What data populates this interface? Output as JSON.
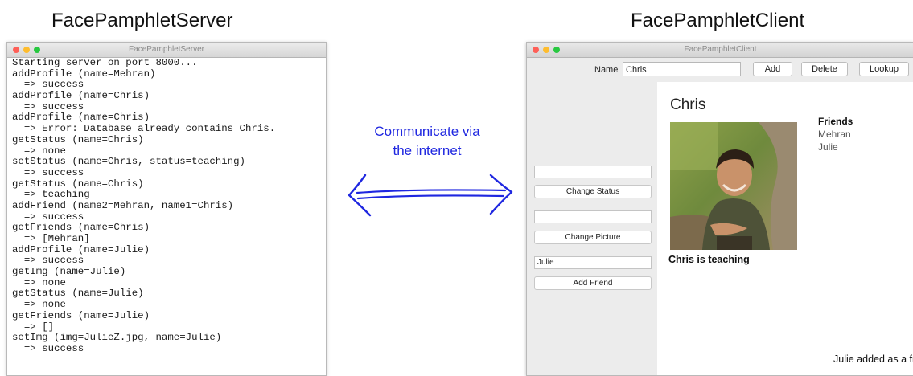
{
  "headings": {
    "server": "FacePamphletServer",
    "client": "FacePamphletClient"
  },
  "colors": {
    "traffic_red": "#fe5f57",
    "traffic_yellow": "#febc2e",
    "traffic_green": "#28c840",
    "arrow": "#1f27e0",
    "panel_gray": "#ececec"
  },
  "server_window": {
    "title": "FacePamphletServer",
    "log": [
      "Starting server on port 8000...",
      "addProfile (name=Mehran)",
      "  => success",
      "addProfile (name=Chris)",
      "  => success",
      "addProfile (name=Chris)",
      "  => Error: Database already contains Chris.",
      "getStatus (name=Chris)",
      "  => none",
      "setStatus (name=Chris, status=teaching)",
      "  => success",
      "getStatus (name=Chris)",
      "  => teaching",
      "addFriend (name2=Mehran, name1=Chris)",
      "  => success",
      "getFriends (name=Chris)",
      "  => [Mehran]",
      "addProfile (name=Julie)",
      "  => success",
      "getImg (name=Julie)",
      "  => none",
      "getStatus (name=Julie)",
      "  => none",
      "getFriends (name=Julie)",
      "  => []",
      "setImg (img=JulieZ.jpg, name=Julie)",
      "  => success"
    ]
  },
  "arrow_label": {
    "line1": "Communicate via",
    "line2": "the internet"
  },
  "client_window": {
    "title": "FacePamphletClient",
    "name_label": "Name",
    "name_value": "Chris",
    "add_label": "Add",
    "delete_label": "Delete",
    "lookup_label": "Lookup",
    "status_field": "",
    "change_status_label": "Change Status",
    "picture_field": "",
    "change_picture_label": "Change Picture",
    "friend_field": "Julie",
    "add_friend_label": "Add Friend",
    "profile_name": "Chris",
    "status_text": "Chris is teaching",
    "friends_title": "Friends",
    "friends": [
      "Mehran",
      "Julie"
    ],
    "message": "Julie added as a friend."
  }
}
